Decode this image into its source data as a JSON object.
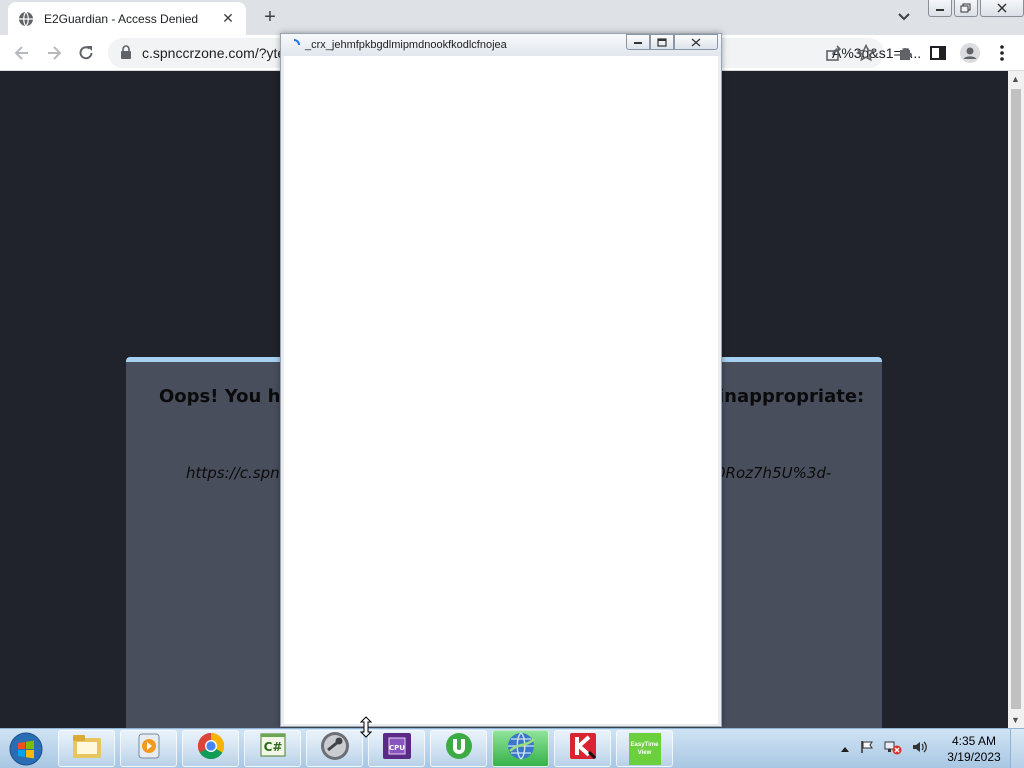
{
  "browser": {
    "tab": {
      "title": "E2Guardian - Access Denied",
      "icon": "globe-icon"
    },
    "new_tab": "+",
    "url_visible_left": "c.spnccrzone.com/?yte",
    "url_visible_right": "A%3d&s1=7..."
  },
  "page": {
    "heading_left": "Oops! You hav",
    "heading_right": "inappropriate:",
    "url_left": "https://c.spn",
    "url_right": "0Roz7h5U%3d-"
  },
  "popup": {
    "title": "_crx_jehmfpkbgdlmipmdnookfkodlcfnojea"
  },
  "taskbar": {
    "apps": [
      "file-explorer-icon",
      "media-center-icon",
      "chrome-icon",
      "csharp-editor-icon",
      "steam-icon",
      "cpu-z-icon",
      "utorrent-icon",
      "globe-network-icon",
      "kaspersky-icon",
      "easytimeview-icon"
    ],
    "easytime_label": "EasyTime View",
    "clock_time": "4:35 AM",
    "clock_date": "3/19/2023"
  }
}
